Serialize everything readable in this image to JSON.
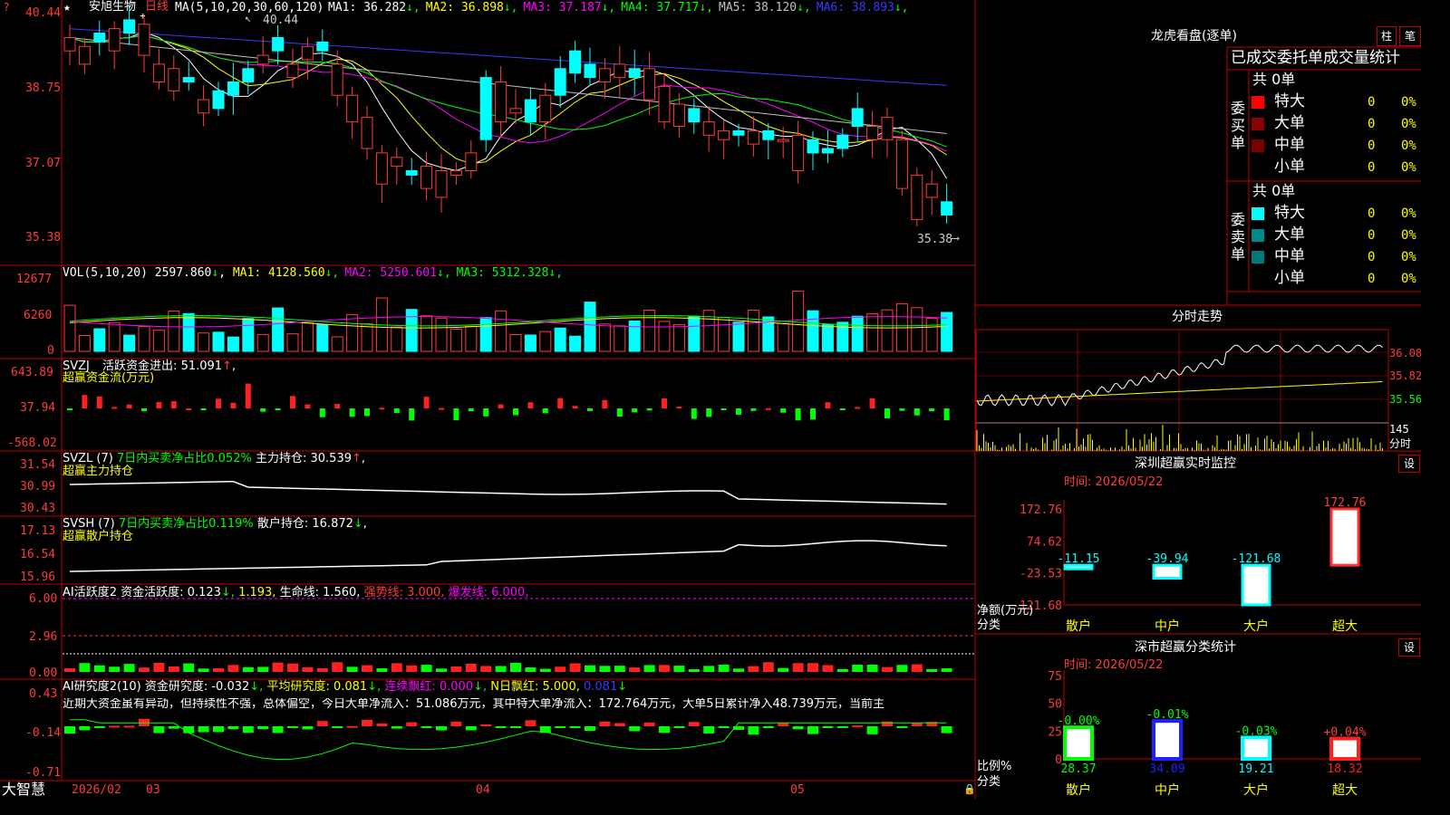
{
  "stock": {
    "name": "安旭生物",
    "period": "日线",
    "star": "★",
    "settings_glyph": "?"
  },
  "ma": {
    "title": "MA(5,10,20,30,60,120)",
    "items": [
      {
        "label": "MA1:",
        "value": "36.282",
        "arrow": "↓",
        "color": "#ffffff"
      },
      {
        "label": "MA2:",
        "value": "36.898",
        "arrow": "↓",
        "color": "#ffff00"
      },
      {
        "label": "MA3:",
        "value": "37.187",
        "arrow": "↓",
        "color": "#ff00ff"
      },
      {
        "label": "MA4:",
        "value": "37.717",
        "arrow": "↓",
        "color": "#00ff00"
      },
      {
        "label": "MA5:",
        "value": "38.120",
        "arrow": "↓",
        "color": "#c0c0c0"
      },
      {
        "label": "MA6:",
        "value": "38.893",
        "arrow": "↓",
        "color": "#3a3aff"
      }
    ],
    "high_mark": "40.44",
    "low_mark": "35.38"
  },
  "price_axis": [
    "40.44",
    "38.75",
    "37.07",
    "35.38"
  ],
  "vol": {
    "title": "VOL(5,10,20)",
    "value": "2597.860",
    "arrow": "↓",
    "items": [
      {
        "label": "MA1:",
        "value": "4128.560",
        "arrow": "↓",
        "color": "#ffff00"
      },
      {
        "label": "MA2:",
        "value": "5250.601",
        "arrow": "↓",
        "color": "#ff00ff"
      },
      {
        "label": "MA3:",
        "value": "5312.328",
        "arrow": "↓",
        "color": "#00ff00"
      }
    ],
    "axis": [
      "12677",
      "6260",
      "0"
    ]
  },
  "svzj": {
    "name": "SVZJ",
    "desc": "活跃资金进出:",
    "value": "51.091",
    "arrow": "↑",
    "sub": "超赢资金流(万元)",
    "axis": [
      "643.89",
      "37.94",
      "-568.02"
    ]
  },
  "svzl": {
    "name": "SVZL (7)",
    "desc": "7日内买卖净占比0.052%",
    "desc2": "主力持仓:",
    "value": "30.539",
    "arrow": "↑",
    "sub": "超赢主力持仓",
    "axis": [
      "31.54",
      "30.99",
      "30.43"
    ]
  },
  "svsh": {
    "name": "SVSH (7)",
    "desc": "7日内买卖净占比0.119%",
    "desc2": "散户持仓:",
    "value": "16.872",
    "arrow": "↓",
    "sub": "超赢散户持仓",
    "axis": [
      "17.13",
      "16.54",
      "15.96"
    ]
  },
  "ai_active": {
    "title": "AI活跃度2",
    "desc": "资金活跃度:",
    "v1": "0.123",
    "v2": "1.193,",
    "life": "生命线: 1.560,",
    "strong": "强势线: 3.000,",
    "burst": "爆发线: 6.000,",
    "axis": [
      "6.00",
      "2.96",
      "0.00"
    ]
  },
  "ai_research": {
    "title": "AI研究度2(10)",
    "desc": "资金研究度:",
    "v1": "-0.032",
    "avg": "平均研究度: 0.081",
    "cont": "连续飘红: 0.000",
    "n": "N日飘红: 5.000,",
    "v2": "0.081",
    "text": "近期大资金虽有异动，但持续性不强，总体偏空，今日大单净流入：51.086万元，其中特大单净流入：172.764万元，大单5日累计净入48.739万元，当前主",
    "axis": [
      "0.43",
      "-0.14",
      "-0.71"
    ]
  },
  "date_axis": {
    "brand": "大智慧",
    "labels": [
      "2026/02",
      "03",
      "04",
      "05"
    ]
  },
  "lhb": {
    "title": "龙虎看盘(逐单)",
    "tab1": "柱",
    "tab2": "笔",
    "header": "已成交委托单成交量统计",
    "buy": {
      "side": "委买单",
      "total": "共 0单",
      "rows": [
        {
          "label": "特大",
          "count": "0",
          "pct": "0%",
          "color": "#ff0000"
        },
        {
          "label": "大单",
          "count": "0",
          "pct": "0%",
          "color": "#8b0000"
        },
        {
          "label": "中单",
          "count": "0",
          "pct": "0%",
          "color": "#7a0000"
        },
        {
          "label": "小单",
          "count": "0",
          "pct": "0%",
          "color": ""
        }
      ]
    },
    "sell": {
      "side": "委卖单",
      "total": "共 0单",
      "rows": [
        {
          "label": "特大",
          "count": "0",
          "pct": "0%",
          "color": "#00ffff"
        },
        {
          "label": "大单",
          "count": "0",
          "pct": "0%",
          "color": "#008b8b"
        },
        {
          "label": "中单",
          "count": "0",
          "pct": "0%",
          "color": "#007a7a"
        },
        {
          "label": "小单",
          "count": "0",
          "pct": "0%",
          "color": ""
        }
      ]
    }
  },
  "intraday": {
    "title": "分时走势",
    "prices": [
      "36.08",
      "35.82",
      "35.56"
    ],
    "vol_label": "145",
    "unit": "分时"
  },
  "realtime": {
    "title": "深圳超赢实时监控",
    "settings": "设",
    "time": "时间: 2026/05/22",
    "ylabel1": "净额(万元)",
    "ylabel2": "分类",
    "axis": [
      "172.76",
      "74.62",
      "-23.53",
      "-121.68"
    ],
    "bars": [
      {
        "cat": "散户",
        "value": -11.15,
        "label": "-11.15"
      },
      {
        "cat": "中户",
        "value": -39.94,
        "label": "-39.94"
      },
      {
        "cat": "大户",
        "value": -121.68,
        "label": "-121.68"
      },
      {
        "cat": "超大",
        "value": 172.76,
        "label": "172.76"
      }
    ]
  },
  "classify": {
    "title": "深市超赢分类统计",
    "settings": "设",
    "time": "时间: 2026/05/22",
    "ylabel1": "比例%",
    "ylabel2": "分类",
    "axis": [
      "75",
      "50",
      "25",
      "0"
    ],
    "bars": [
      {
        "cat": "散户",
        "value": 28.37,
        "label": "28.37",
        "chg": "-0.00%",
        "color": "#00ff00"
      },
      {
        "cat": "中户",
        "value": 34.09,
        "label": "34.09",
        "chg": "-0.01%",
        "color": "#2020ff"
      },
      {
        "cat": "大户",
        "value": 19.21,
        "label": "19.21",
        "chg": "-0.03%",
        "color": "#00ffff"
      },
      {
        "cat": "超大",
        "value": 18.32,
        "label": "18.32",
        "chg": "+0.04%",
        "color": "#ff2020"
      }
    ]
  }
}
